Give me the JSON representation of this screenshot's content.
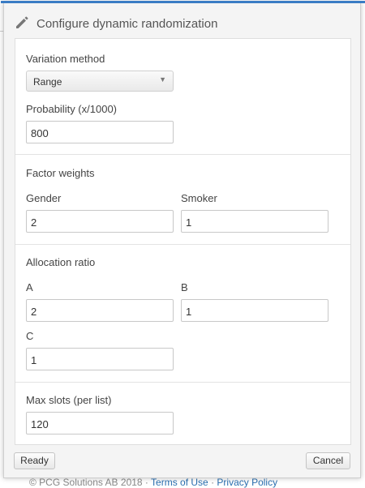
{
  "background": {
    "footer_text": "© PCG Solutions AB 2018 · ",
    "terms_link": "Terms of Use",
    "separator": " · ",
    "privacy_link": "Privacy Policy"
  },
  "dialog": {
    "title": "Configure dynamic randomization",
    "title_icon": "pencil-icon",
    "variation_method": {
      "label": "Variation method",
      "value": "Range"
    },
    "probability": {
      "label": "Probability (x/1000)",
      "value": "800"
    },
    "factor_weights": {
      "heading": "Factor weights",
      "gender_label": "Gender",
      "gender_value": "2",
      "smoker_label": "Smoker",
      "smoker_value": "1"
    },
    "allocation_ratio": {
      "heading": "Allocation ratio",
      "a_label": "A",
      "a_value": "2",
      "b_label": "B",
      "b_value": "1",
      "c_label": "C",
      "c_value": "1"
    },
    "max_slots": {
      "label": "Max slots (per list)",
      "value": "120"
    },
    "buttons": {
      "ready": "Ready",
      "cancel": "Cancel"
    }
  },
  "colors": {
    "accent": "#3a7cc4",
    "link": "#2a6fb0"
  }
}
